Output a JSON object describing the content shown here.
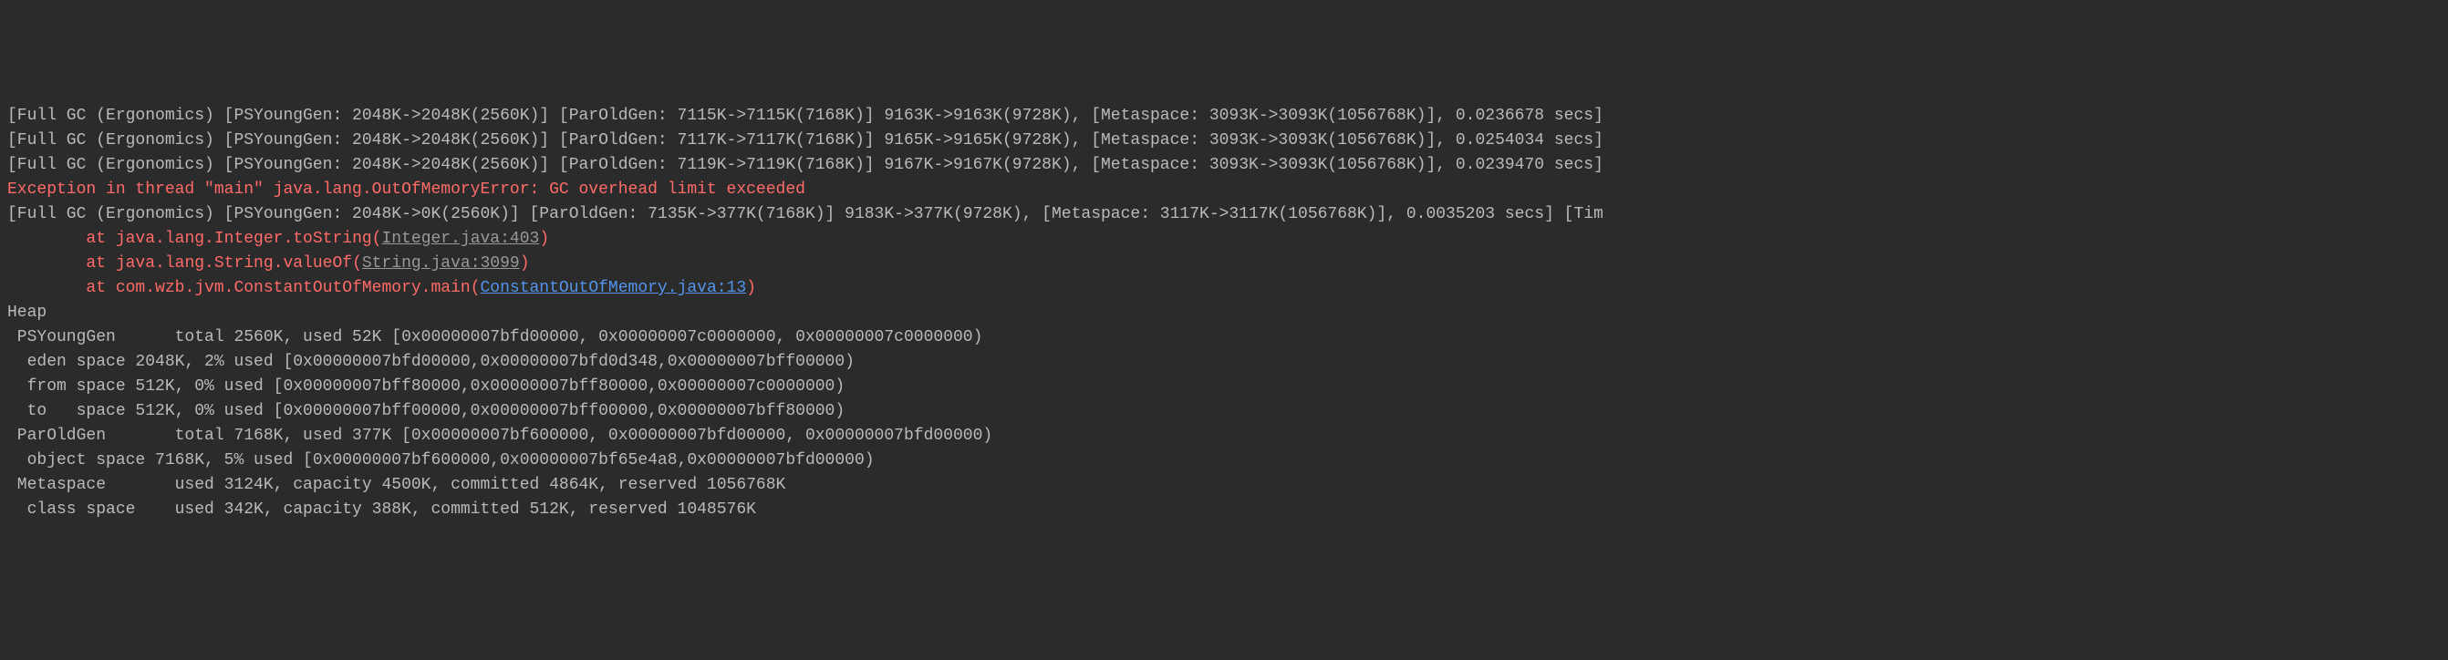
{
  "console": {
    "gc": [
      "[Full GC (Ergonomics) [PSYoungGen: 2048K->2048K(2560K)] [ParOldGen: 7115K->7115K(7168K)] 9163K->9163K(9728K), [Metaspace: 3093K->3093K(1056768K)], 0.0236678 secs]",
      "[Full GC (Ergonomics) [PSYoungGen: 2048K->2048K(2560K)] [ParOldGen: 7117K->7117K(7168K)] 9165K->9165K(9728K), [Metaspace: 3093K->3093K(1056768K)], 0.0254034 secs]",
      "[Full GC (Ergonomics) [PSYoungGen: 2048K->2048K(2560K)] [ParOldGen: 7119K->7119K(7168K)] 9167K->9167K(9728K), [Metaspace: 3093K->3093K(1056768K)], 0.0239470 secs]"
    ],
    "exception_header": "Exception in thread \"main\" java.lang.OutOfMemoryError: GC overhead limit exceeded",
    "gc_mid": "[Full GC (Ergonomics) [PSYoungGen: 2048K->0K(2560K)] [ParOldGen: 7135K->377K(7168K)] 9183K->377K(9728K), [Metaspace: 3117K->3117K(1056768K)], 0.0035203 secs] [Tim",
    "stack": [
      {
        "prefix": "\tat java.lang.Integer.toString(",
        "link": "Integer.java:403",
        "suffix": ")",
        "link_class": "link"
      },
      {
        "prefix": "\tat java.lang.String.valueOf(",
        "link": "String.java:3099",
        "suffix": ")",
        "link_class": "link"
      },
      {
        "prefix": "\tat com.wzb.jvm.ConstantOutOfMemory.main(",
        "link": "ConstantOutOfMemory.java:13",
        "suffix": ")",
        "link_class": "link-blue"
      }
    ],
    "heap_header": "Heap",
    "heap_lines": [
      " PSYoungGen      total 2560K, used 52K [0x00000007bfd00000, 0x00000007c0000000, 0x00000007c0000000)",
      "  eden space 2048K, 2% used [0x00000007bfd00000,0x00000007bfd0d348,0x00000007bff00000)",
      "  from space 512K, 0% used [0x00000007bff80000,0x00000007bff80000,0x00000007c0000000)",
      "  to   space 512K, 0% used [0x00000007bff00000,0x00000007bff00000,0x00000007bff80000)",
      " ParOldGen       total 7168K, used 377K [0x00000007bf600000, 0x00000007bfd00000, 0x00000007bfd00000)",
      "  object space 7168K, 5% used [0x00000007bf600000,0x00000007bf65e4a8,0x00000007bfd00000)",
      " Metaspace       used 3124K, capacity 4500K, committed 4864K, reserved 1056768K",
      "  class space    used 342K, capacity 388K, committed 512K, reserved 1048576K"
    ]
  }
}
